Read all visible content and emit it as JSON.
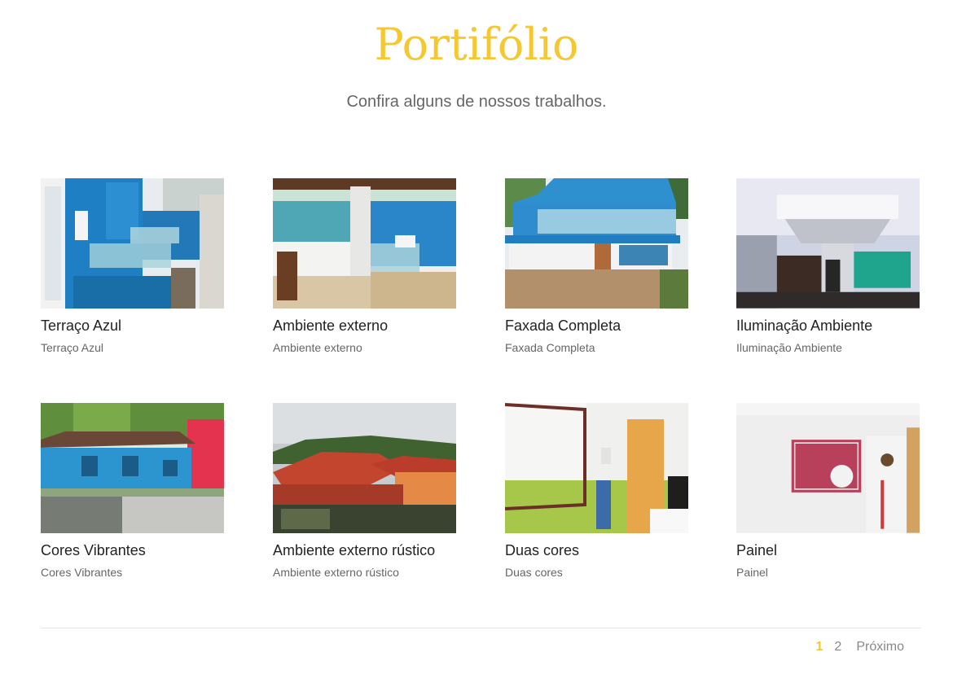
{
  "header": {
    "title": "Portifólio",
    "subtitle": "Confira alguns de nossos trabalhos."
  },
  "colors": {
    "accent": "#f5c832",
    "text_dark": "#222222",
    "text_muted": "#666666"
  },
  "portfolio": {
    "items": [
      {
        "title": "Terraço Azul",
        "caption": "Terraço Azul",
        "image": "blue-house-terrace-photo"
      },
      {
        "title": "Ambiente externo",
        "caption": "Ambiente externo",
        "image": "outdoor-area-photo"
      },
      {
        "title": "Faxada Completa",
        "caption": "Faxada Completa",
        "image": "blue-facade-photo"
      },
      {
        "title": "Iluminação Ambiente",
        "caption": "Iluminação Ambiente",
        "image": "ceiling-lighting-kitchen-photo"
      },
      {
        "title": "Cores Vibrantes",
        "caption": "Cores Vibrantes",
        "image": "blue-red-houses-photo"
      },
      {
        "title": "Ambiente externo rústico",
        "caption": "Ambiente externo rústico",
        "image": "rustic-tile-roof-photo"
      },
      {
        "title": "Duas cores",
        "caption": "Duas cores",
        "image": "two-tone-wall-photo"
      },
      {
        "title": "Painel",
        "caption": "Painel",
        "image": "wall-panel-photo"
      }
    ]
  },
  "pagination": {
    "pages": [
      "1",
      "2"
    ],
    "current": "1",
    "next_label": "Próximo"
  }
}
